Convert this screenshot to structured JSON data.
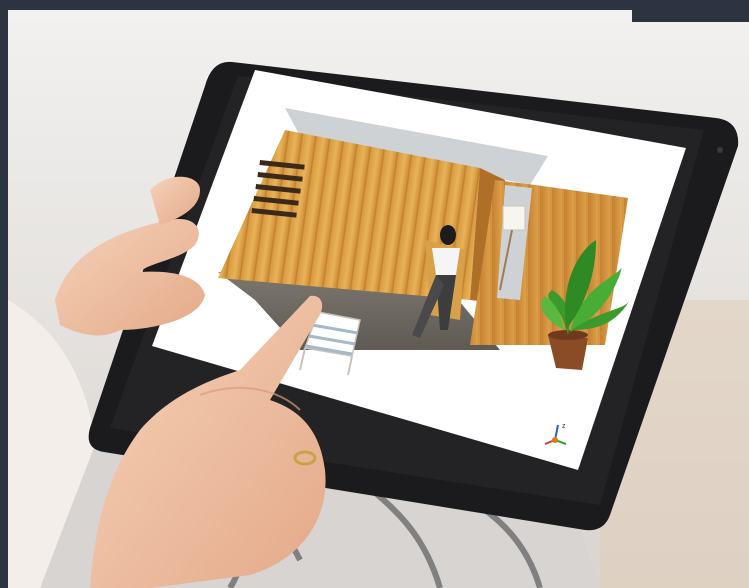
{
  "scene": {
    "colors": {
      "background_wall": "#e9e7e5",
      "tablet_frame": "#1b1b1d",
      "screen": "#ffffff",
      "wood_light": "#e8b35a",
      "wood_dark": "#b9792b",
      "floor": "#6f6a63",
      "skin": "#f2c6a8",
      "sleeve": "#f3eeea",
      "plant": "#3c9a2c",
      "pot": "#8a4b27",
      "frame_bar": "#2b3440"
    },
    "axis_gizmo": {
      "labels": [
        "z",
        "x",
        "y"
      ]
    }
  }
}
